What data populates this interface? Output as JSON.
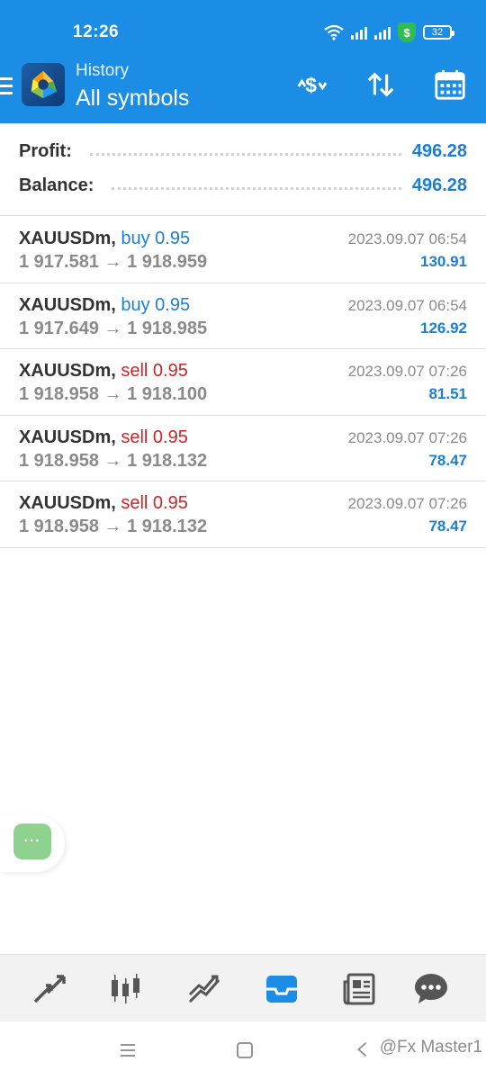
{
  "status_bar": {
    "time": "12:26",
    "battery": "32",
    "shield_symbol": "$"
  },
  "toolbar": {
    "section": "History",
    "filter": "All symbols"
  },
  "summary": {
    "profit_label": "Profit:",
    "profit_value": "496.28",
    "balance_label": "Balance:",
    "balance_value": "496.28"
  },
  "deals": [
    {
      "symbol": "XAUUSDm,",
      "side": "buy 0.95",
      "type": "buy",
      "prices": "1 917.581 → 1 918.959",
      "time": "2023.09.07 06:54",
      "profit": "130.91"
    },
    {
      "symbol": "XAUUSDm,",
      "side": "buy 0.95",
      "type": "buy",
      "prices": "1 917.649 → 1 918.985",
      "time": "2023.09.07 06:54",
      "profit": "126.92"
    },
    {
      "symbol": "XAUUSDm,",
      "side": "sell 0.95",
      "type": "sell",
      "prices": "1 918.958 → 1 918.100",
      "time": "2023.09.07 07:26",
      "profit": "81.51"
    },
    {
      "symbol": "XAUUSDm,",
      "side": "sell 0.95",
      "type": "sell",
      "prices": "1 918.958 → 1 918.132",
      "time": "2023.09.07 07:26",
      "profit": "78.47"
    },
    {
      "symbol": "XAUUSDm,",
      "side": "sell 0.95",
      "type": "sell",
      "prices": "1 918.958 → 1 918.132",
      "time": "2023.09.07 07:26",
      "profit": "78.47"
    }
  ],
  "floating_button": {
    "label": "···"
  },
  "bottom_nav": {
    "items": [
      {
        "name": "quotes-icon",
        "active": false
      },
      {
        "name": "chart-icon",
        "active": false
      },
      {
        "name": "trade-icon",
        "active": false
      },
      {
        "name": "history-icon",
        "active": true
      },
      {
        "name": "news-icon",
        "active": false
      },
      {
        "name": "chat-icon",
        "active": false
      }
    ]
  },
  "watermark": "@Fx Master1",
  "colors": {
    "header": "#1c8de4",
    "buy": "#1c7fd4",
    "sell": "#c62828",
    "active_tab": "#1c8de4"
  }
}
